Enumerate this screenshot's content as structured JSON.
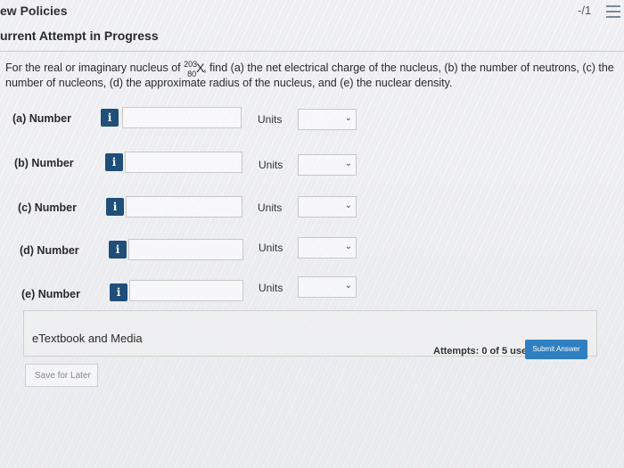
{
  "header": {
    "title": "ew Policies",
    "score": "-/1",
    "menu_icon": "hamburger-menu-icon"
  },
  "attempt_status": "urrent Attempt in Progress",
  "question": {
    "intro": "For the real or imaginary nucleus of ",
    "nuclide": {
      "mass_number": "203",
      "atomic_number": "80",
      "symbol": "X"
    },
    "rest": ", find (a) the net electrical charge of the nucleus, (b) the number of neutrons, (c) the number of nucleons, (d) the approximate radius of the nucleus, and (e) the nuclear density."
  },
  "parts": [
    {
      "label": "(a)  Number",
      "info": "i",
      "value": "",
      "units_label": "Units",
      "units_value": ""
    },
    {
      "label": "(b)  Number",
      "info": "i",
      "value": "",
      "units_label": "Units",
      "units_value": ""
    },
    {
      "label": "(c)  Number",
      "info": "i",
      "value": "",
      "units_label": "Units",
      "units_value": ""
    },
    {
      "label": "(d)  Number",
      "info": "i",
      "value": "",
      "units_label": "Units",
      "units_value": ""
    },
    {
      "label": "(e)  Number",
      "info": "i",
      "value": "",
      "units_label": "Units",
      "units_value": ""
    }
  ],
  "etextbook": {
    "label": "eTextbook and Media"
  },
  "footer": {
    "attempts": "Attempts: 0 of 5 used",
    "submit_label": "Submit Answer",
    "save_label": "Save for Later"
  },
  "colors": {
    "info_button": "#1f4e79",
    "submit_button": "#2f7fc1"
  }
}
